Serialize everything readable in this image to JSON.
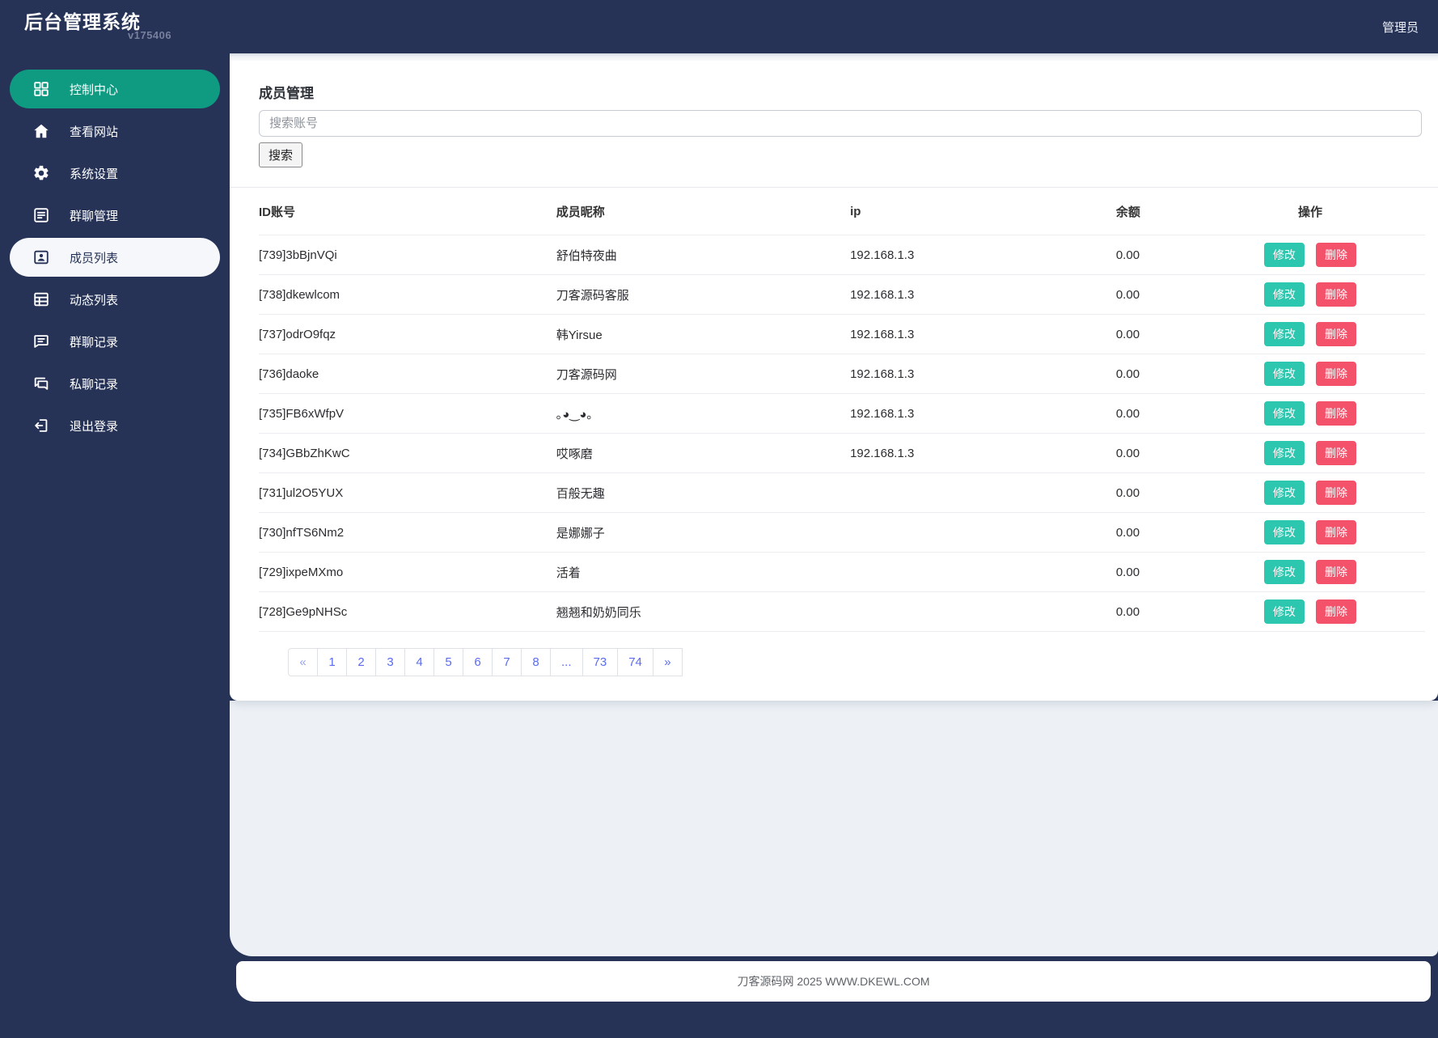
{
  "topbar": {
    "title": "后台管理系统",
    "version": "v175406",
    "user": "管理员"
  },
  "sidebar": {
    "items": [
      {
        "key": "control-center",
        "icon": "grid",
        "label": "控制中心",
        "state": "teal"
      },
      {
        "key": "view-site",
        "icon": "home",
        "label": "查看网站",
        "state": ""
      },
      {
        "key": "settings",
        "icon": "gear",
        "label": "系统设置",
        "state": ""
      },
      {
        "key": "group-manage",
        "icon": "doc",
        "label": "群聊管理",
        "state": ""
      },
      {
        "key": "member-list",
        "icon": "badge",
        "label": "成员列表",
        "state": "light"
      },
      {
        "key": "feed-list",
        "icon": "table",
        "label": "动态列表",
        "state": ""
      },
      {
        "key": "group-log",
        "icon": "chat-lines",
        "label": "群聊记录",
        "state": ""
      },
      {
        "key": "private-log",
        "icon": "chat-double",
        "label": "私聊记录",
        "state": ""
      },
      {
        "key": "logout",
        "icon": "logout",
        "label": "退出登录",
        "state": ""
      }
    ]
  },
  "page": {
    "title": "成员管理",
    "search_placeholder": "搜索账号",
    "search_button": "搜索"
  },
  "table": {
    "headers": [
      "ID账号",
      "成员昵称",
      "ip",
      "余额",
      "操作"
    ],
    "actions": {
      "edit": "修改",
      "delete": "删除"
    },
    "rows": [
      {
        "id": "[739]3bBjnVQi",
        "nick": "舒伯特夜曲",
        "ip": "192.168.1.3",
        "balance": "0.00"
      },
      {
        "id": "[738]dkewlcom",
        "nick": "刀客源码客服",
        "ip": "192.168.1.3",
        "balance": "0.00"
      },
      {
        "id": "[737]odrO9fqz",
        "nick": "韩Yirsue",
        "ip": "192.168.1.3",
        "balance": "0.00"
      },
      {
        "id": "[736]daoke",
        "nick": "刀客源码网",
        "ip": "192.168.1.3",
        "balance": "0.00"
      },
      {
        "id": "[735]FB6xWfpV",
        "nick": "｡◕‿◕｡",
        "ip": "192.168.1.3",
        "balance": "0.00"
      },
      {
        "id": "[734]GBbZhKwC",
        "nick": "哎啄磨",
        "ip": "192.168.1.3",
        "balance": "0.00"
      },
      {
        "id": "[731]ul2O5YUX",
        "nick": "百般无趣",
        "ip": "",
        "balance": "0.00"
      },
      {
        "id": "[730]nfTS6Nm2",
        "nick": "是娜娜子",
        "ip": "",
        "balance": "0.00"
      },
      {
        "id": "[729]ixpeMXmo",
        "nick": "活着",
        "ip": "",
        "balance": "0.00"
      },
      {
        "id": "[728]Ge9pNHSc",
        "nick": "翘翘和奶奶同乐",
        "ip": "",
        "balance": "0.00"
      }
    ]
  },
  "pagination": {
    "items": [
      "«",
      "1",
      "2",
      "3",
      "4",
      "5",
      "6",
      "7",
      "8",
      "...",
      "73",
      "74",
      "»"
    ]
  },
  "footer": {
    "text": "刀客源码网 2025 WWW.DKEWL.COM"
  },
  "colors": {
    "navy": "#263357",
    "active_teal": "#0f9b81",
    "edit_teal": "#2cc7ae",
    "delete_red": "#f4526b",
    "link_blue": "#5b6cf0",
    "content_gray": "#edf1f6"
  }
}
